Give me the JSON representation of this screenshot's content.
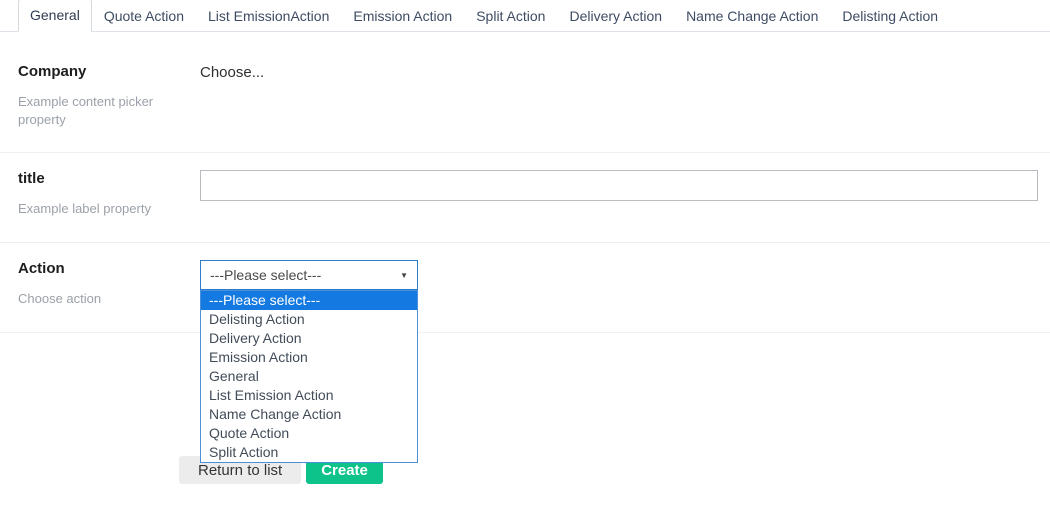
{
  "tabs": [
    {
      "label": "General",
      "active": true
    },
    {
      "label": "Quote Action",
      "active": false
    },
    {
      "label": "List EmissionAction",
      "active": false
    },
    {
      "label": "Emission Action",
      "active": false
    },
    {
      "label": "Split Action",
      "active": false
    },
    {
      "label": "Delivery Action",
      "active": false
    },
    {
      "label": "Name Change Action",
      "active": false
    },
    {
      "label": "Delisting Action",
      "active": false
    }
  ],
  "form": {
    "company": {
      "label": "Company",
      "description": "Example content picker property",
      "choose_label": "Choose..."
    },
    "title": {
      "label": "title",
      "description": "Example label property",
      "value": "",
      "placeholder": ""
    },
    "action": {
      "label": "Action",
      "description": "Choose action",
      "selected": "---Please select---",
      "highlighted_index": 0,
      "options": [
        "---Please select---",
        "Delisting Action",
        "Delivery Action",
        "Emission Action",
        "General",
        "List Emission Action",
        "Name Change Action",
        "Quote Action",
        "Split Action"
      ]
    }
  },
  "footer": {
    "return_label": "Return to list",
    "create_label": "Create"
  },
  "icons": {
    "caret_down": "▼"
  },
  "colors": {
    "select_focus_border": "#2e7cc9",
    "dropdown_border": "#4a90d9",
    "option_highlight": "#1479e0",
    "create_green": "#0dc389",
    "return_gray": "#ececec"
  }
}
